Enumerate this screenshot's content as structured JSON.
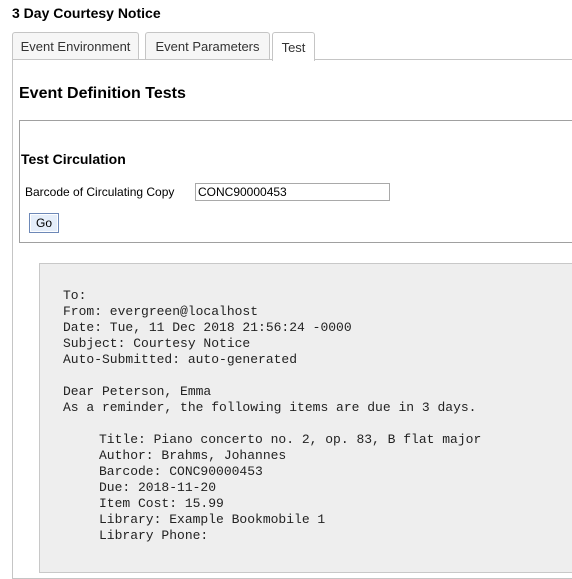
{
  "page": {
    "title": "3 Day Courtesy Notice"
  },
  "tabs": [
    {
      "label": "Event Environment"
    },
    {
      "label": "Event Parameters"
    },
    {
      "label": "Test",
      "active": true
    }
  ],
  "section": {
    "title": "Event Definition Tests"
  },
  "test_circulation": {
    "title": "Test Circulation",
    "barcode_label": "Barcode of Circulating Copy",
    "barcode_value": "CONC90000453",
    "go_label": "Go"
  },
  "output": {
    "header_lines": [
      "To:",
      "From: evergreen@localhost",
      "Date: Tue, 11 Dec 2018 21:56:24 -0000",
      "Subject: Courtesy Notice",
      "Auto-Submitted: auto-generated"
    ],
    "greeting": "Dear Peterson, Emma",
    "intro": "As a reminder, the following items are due in 3 days.",
    "item_lines": [
      "Title: Piano concerto no. 2, op. 83, B flat major",
      "Author: Brahms, Johannes",
      "Barcode: CONC90000453",
      "Due: 2018-11-20",
      "Item Cost: 15.99",
      "Library: Example Bookmobile 1",
      "Library Phone:"
    ]
  }
}
